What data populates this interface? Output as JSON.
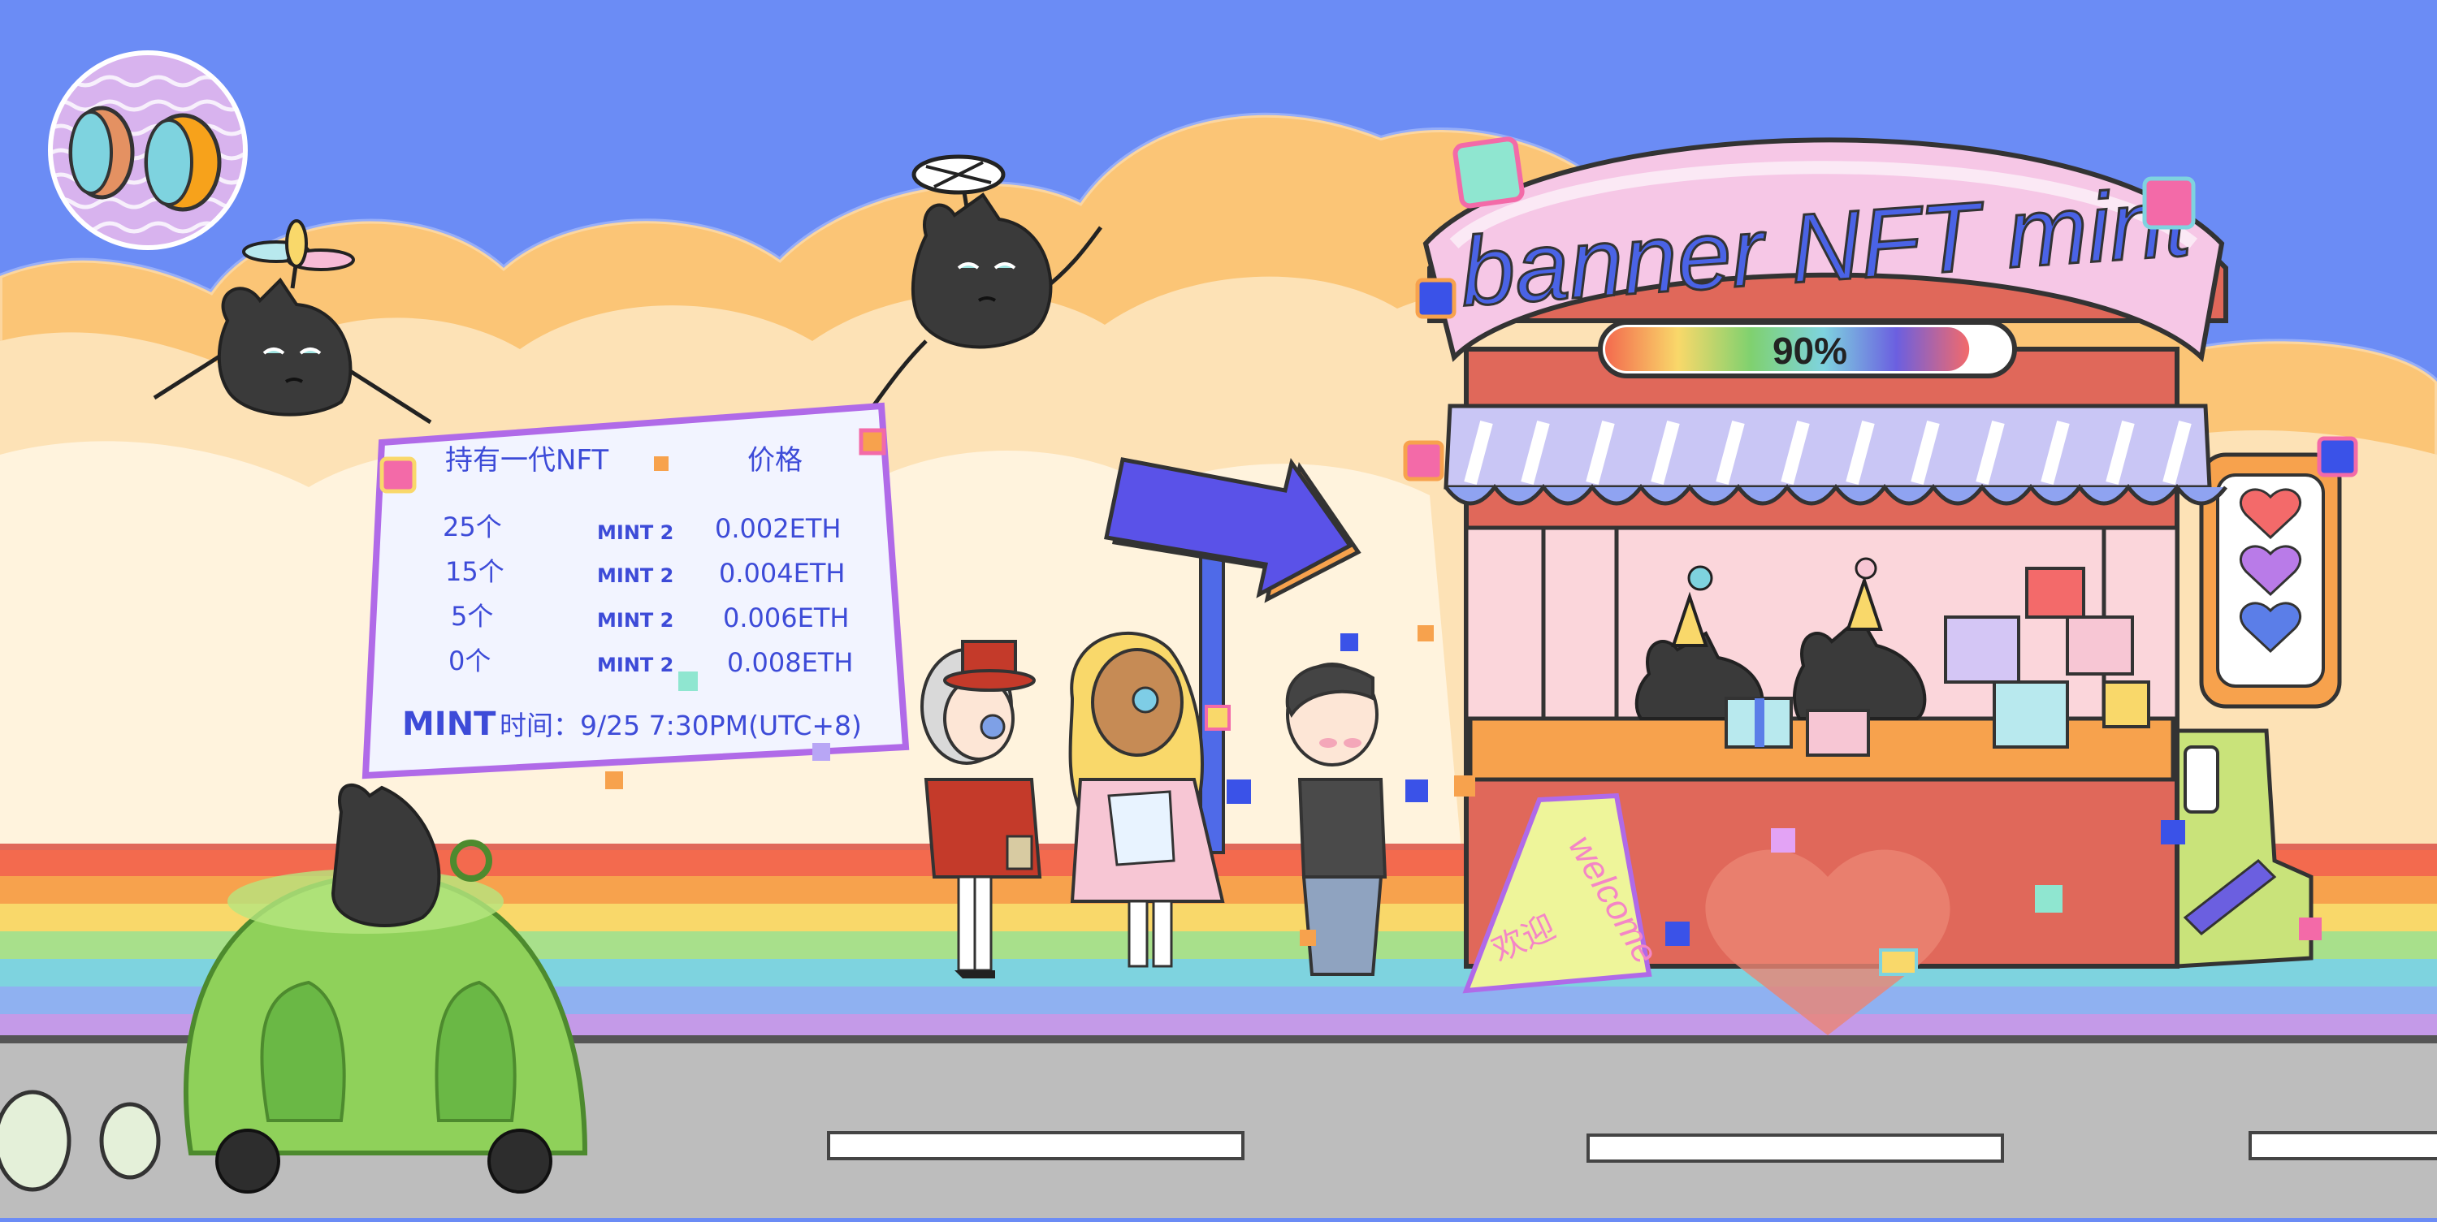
{
  "banner": {
    "title": "banner NFT mint",
    "progress_text": "90%",
    "progress_fraction": 0.9
  },
  "price_sign": {
    "col_holding": "持有一代NFT",
    "col_price": "价格",
    "rows": [
      {
        "held": "25个",
        "mint": "MINT 2",
        "price": "0.002ETH"
      },
      {
        "held": "15个",
        "mint": "MINT 2",
        "price": "0.004ETH"
      },
      {
        "held": "5个",
        "mint": "MINT 2",
        "price": "0.006ETH"
      },
      {
        "held": "0个",
        "mint": "MINT 2",
        "price": "0.008ETH"
      }
    ],
    "mint_time_label": "MINT",
    "mint_time_value": "时间：9/25 7:30PM(UTC+8)"
  },
  "welcome_board": {
    "text": "welcome",
    "subtext": "欢迎"
  },
  "colors": {
    "sky": "#6b8cf5",
    "cloud": "#fbc576",
    "title_blue": "#4a63e6",
    "booth_red": "#e0685a",
    "road": "#bdbdbd"
  },
  "rainbow_stripes": [
    "#f36a4e",
    "#f7a24d",
    "#f9d86a",
    "#a8e08b",
    "#7ed3df",
    "#8fb1f1",
    "#c49ae8"
  ],
  "icons": {
    "moon": "moon-icon",
    "arrow": "arrow-sign-icon",
    "car": "jelly-car-icon"
  }
}
